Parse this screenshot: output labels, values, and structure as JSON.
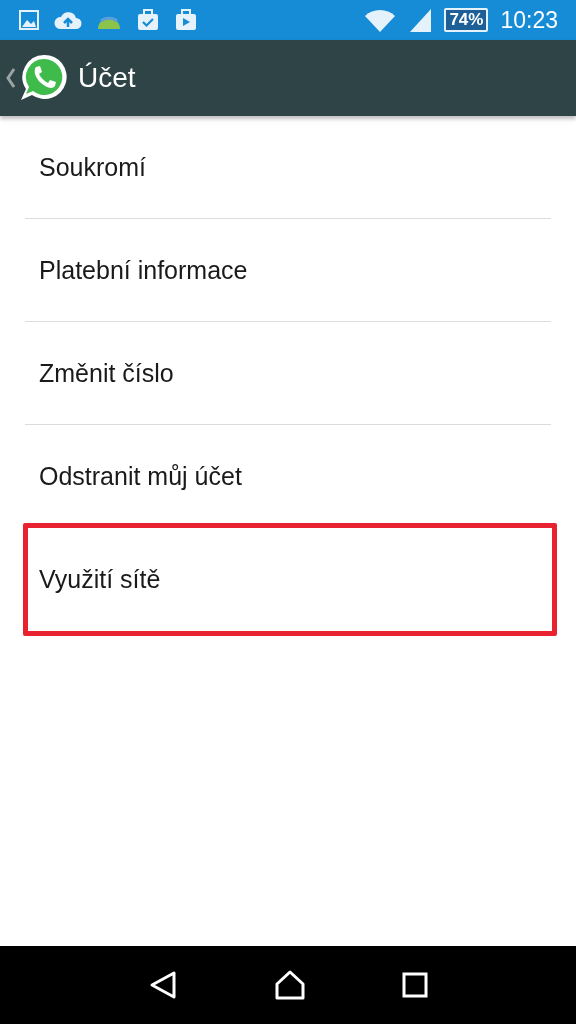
{
  "status_bar": {
    "battery": "74%",
    "time": "10:23"
  },
  "app_bar": {
    "title": "Účet"
  },
  "items": [
    {
      "label": "Soukromí",
      "highlighted": false
    },
    {
      "label": "Platební informace",
      "highlighted": false
    },
    {
      "label": "Změnit číslo",
      "highlighted": false
    },
    {
      "label": "Odstranit můj účet",
      "highlighted": false
    },
    {
      "label": "Využití sítě",
      "highlighted": true
    }
  ]
}
